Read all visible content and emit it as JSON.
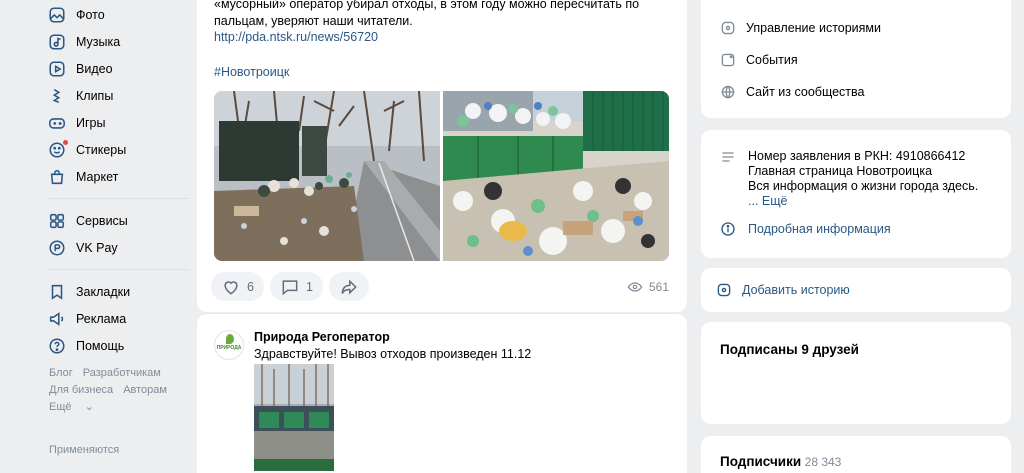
{
  "nav": {
    "items": [
      {
        "label": "Фото",
        "icon": "photo-icon"
      },
      {
        "label": "Музыка",
        "icon": "music-icon"
      },
      {
        "label": "Видео",
        "icon": "video-icon"
      },
      {
        "label": "Клипы",
        "icon": "clips-icon"
      },
      {
        "label": "Игры",
        "icon": "games-icon"
      },
      {
        "label": "Стикеры",
        "icon": "stickers-icon"
      },
      {
        "label": "Маркет",
        "icon": "market-icon"
      }
    ],
    "items2": [
      {
        "label": "Сервисы",
        "icon": "services-icon"
      },
      {
        "label": "VK Pay",
        "icon": "vkpay-icon"
      }
    ],
    "items3": [
      {
        "label": "Закладки",
        "icon": "bookmarks-icon"
      },
      {
        "label": "Реклама",
        "icon": "ads-icon"
      },
      {
        "label": "Помощь",
        "icon": "help-icon"
      }
    ],
    "footer": {
      "blog": "Блог",
      "developers": "Разработчикам",
      "business": "Для бизнеса",
      "authors": "Авторам",
      "more": "Ещё"
    },
    "applied": "Применяются"
  },
  "post1": {
    "text": "«мусорный» оператор убирал отходы, в этом году можно пересчитать по пальцам, уверяют наши читатели.",
    "link": "http://pda.ntsk.ru/news/56720",
    "tag": "#Новотроицк",
    "likes": "6",
    "comments": "1",
    "views": "561"
  },
  "post2": {
    "author": "Природа Регоператор",
    "avatar_text": "ПРИРОДА",
    "text": "Здравствуйте! Вывоз отходов произведен 11.12"
  },
  "right": {
    "menu": [
      {
        "label": "Управление историями",
        "icon": "stories-manage-icon"
      },
      {
        "label": "События",
        "icon": "events-icon"
      },
      {
        "label": "Сайт из сообщества",
        "icon": "website-icon"
      }
    ],
    "info": {
      "line1": "Номер заявления в РКН: 4910866412",
      "line2": "Главная страница Новотроицка",
      "line3": "Вся информация о жизни города здесь.",
      "more": "... Ещё",
      "details": "Подробная информация"
    },
    "add_story": "Добавить историю",
    "friends_title": "Подписаны 9 друзей",
    "followers_title": "Подписчики",
    "followers_count": "28 343"
  },
  "colors": {
    "accent": "#2a5885",
    "background": "#edeef0",
    "muted": "#818c99"
  }
}
